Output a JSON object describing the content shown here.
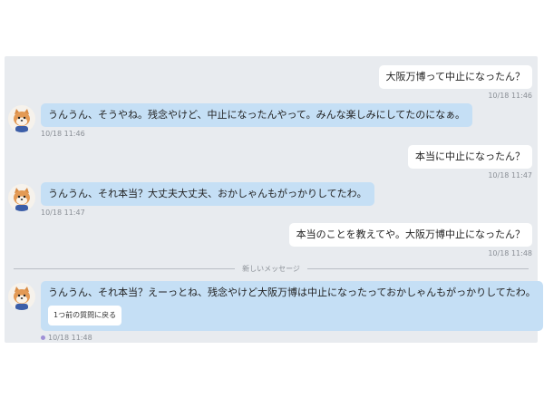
{
  "messages": [
    {
      "type": "sent",
      "text": "大阪万博って中止になったん？",
      "time": "10/18 11:46"
    },
    {
      "type": "received",
      "text": "うんうん、そうやね。残念やけど、中止になったんやって。みんな楽しみにしてたのになぁ。",
      "time": "10/18 11:46"
    },
    {
      "type": "sent",
      "text": "本当に中止になったん？",
      "time": "10/18 11:47"
    },
    {
      "type": "received",
      "text": "うんうん、それ本当？大丈夫大丈夫、おかしゃんもがっかりしてたわ。",
      "time": "10/18 11:47"
    },
    {
      "type": "sent",
      "text": "本当のことを教えてや。大阪万博中止になったん？",
      "time": "10/18 11:48"
    },
    {
      "type": "received",
      "text": "うんうん、それ本当？えーっとね、残念やけど大阪万博は中止になったっておかしゃんもがっかりしてたわ。",
      "time": "10/18 11:48",
      "button": "1つ前の質問に戻る"
    }
  ],
  "divider": {
    "label": "新しいメッセージ"
  },
  "colors": {
    "background": "#e8ebef",
    "sent_bubble": "#ffffff",
    "received_bubble": "#c5dff5",
    "unread_dot": "#9f8fd6"
  },
  "icons": {
    "avatar": "shiba-dog-avatar-icon"
  }
}
